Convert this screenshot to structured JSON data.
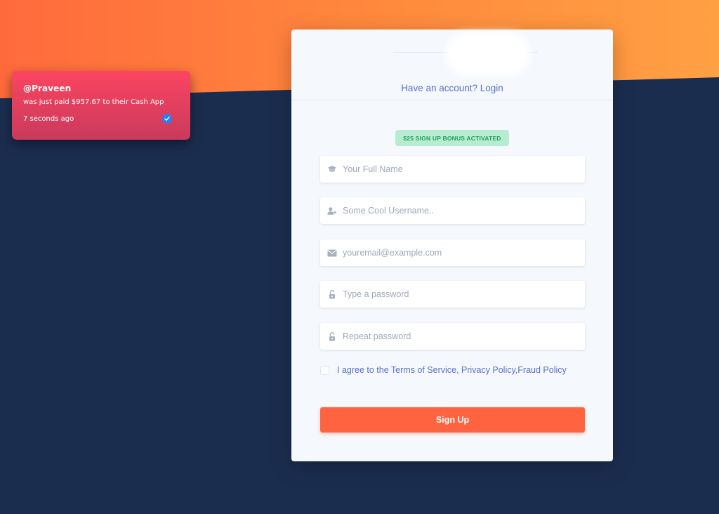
{
  "toast": {
    "user": "@Praveen",
    "message": "was just paid $957.67 to their Cash App",
    "time": "7 seconds ago"
  },
  "card": {
    "login_link": "Have an account? Login",
    "bonus_badge": "$25 SIGN UP BONUS ACTIVATED",
    "fields": {
      "full_name": {
        "placeholder": "Your Full Name",
        "icon": "graduation-cap-icon"
      },
      "username": {
        "placeholder": "Some Cool Username..",
        "icon": "user-plus-icon"
      },
      "email": {
        "placeholder": "youremail@example.com",
        "icon": "envelope-icon"
      },
      "password": {
        "placeholder": "Type a password",
        "icon": "unlock-icon"
      },
      "repeat_password": {
        "placeholder": "Repeat password",
        "icon": "unlock-icon"
      }
    },
    "agree_text": "I agree to the Terms of Service, Privacy Policy,Fraud Policy",
    "signup_label": "Sign Up"
  },
  "colors": {
    "accent": "#ff6340",
    "badge_bg": "#b8ecd0",
    "badge_text": "#22a062",
    "link": "#5a72c2",
    "page_bg": "#1b2d4f"
  }
}
